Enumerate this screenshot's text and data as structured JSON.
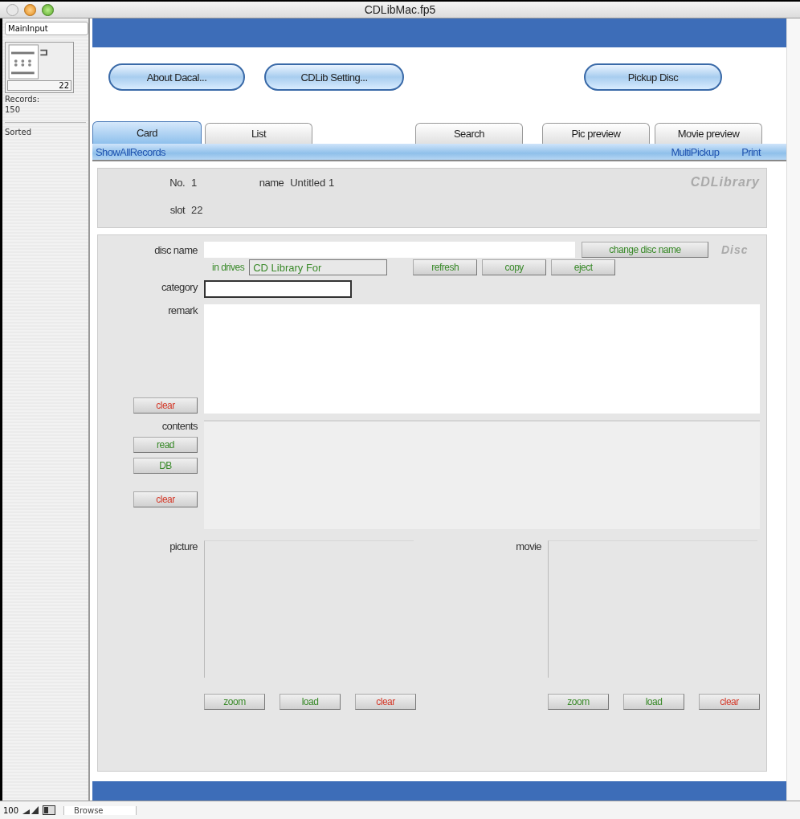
{
  "window": {
    "title": "CDLibMac.fp5"
  },
  "sidebar": {
    "layout": "MainInput",
    "record_number": "22",
    "records_label": "Records:",
    "records_count": "150",
    "sort_state": "Sorted"
  },
  "top_buttons": [
    {
      "label": "About Dacal..."
    },
    {
      "label": "CDLib Setting..."
    },
    {
      "label": "Pickup Disc"
    }
  ],
  "tabs": [
    {
      "label": "Card",
      "selected": true
    },
    {
      "label": "List",
      "selected": false
    },
    {
      "label": "Search",
      "selected": false
    },
    {
      "label": "Pic preview",
      "selected": false
    },
    {
      "label": "Movie preview",
      "selected": false
    }
  ],
  "subbar": {
    "left": "ShowAllRecords",
    "links": [
      "MultiPickup",
      "Print"
    ]
  },
  "header": {
    "no_label": "No.",
    "no_value": "1",
    "name_label": "name",
    "name_value": "Untitled 1",
    "brand": "CDLibrary",
    "slot_label": "slot",
    "slot_value": "22"
  },
  "disc": {
    "label": "disc name",
    "change_button": "change disc name",
    "section_label": "Disc",
    "drives_label": "in drives",
    "drives_value": "CD Library For",
    "buttons": [
      {
        "label": "refresh",
        "kind": "normal"
      },
      {
        "label": "copy",
        "kind": "normal"
      },
      {
        "label": "eject",
        "kind": "normal"
      }
    ]
  },
  "category": {
    "label": "category"
  },
  "remark": {
    "label": "remark",
    "buttons": [
      {
        "label": "clear",
        "kind": "destructive"
      }
    ]
  },
  "contents": {
    "label": "contents",
    "buttons": [
      {
        "label": "read",
        "kind": "normal"
      },
      {
        "label": "DB",
        "kind": "normal"
      },
      {
        "label": "clear",
        "kind": "destructive"
      }
    ]
  },
  "media": [
    {
      "label": "picture",
      "buttons": [
        {
          "label": "zoom",
          "kind": "normal"
        },
        {
          "label": "load",
          "kind": "normal"
        },
        {
          "label": "clear",
          "kind": "destructive"
        }
      ]
    },
    {
      "label": "movie",
      "buttons": [
        {
          "label": "zoom",
          "kind": "normal"
        },
        {
          "label": "load",
          "kind": "normal"
        },
        {
          "label": "clear",
          "kind": "destructive"
        }
      ]
    }
  ],
  "status_bar": {
    "zoom": "100",
    "mode": "Browse"
  }
}
